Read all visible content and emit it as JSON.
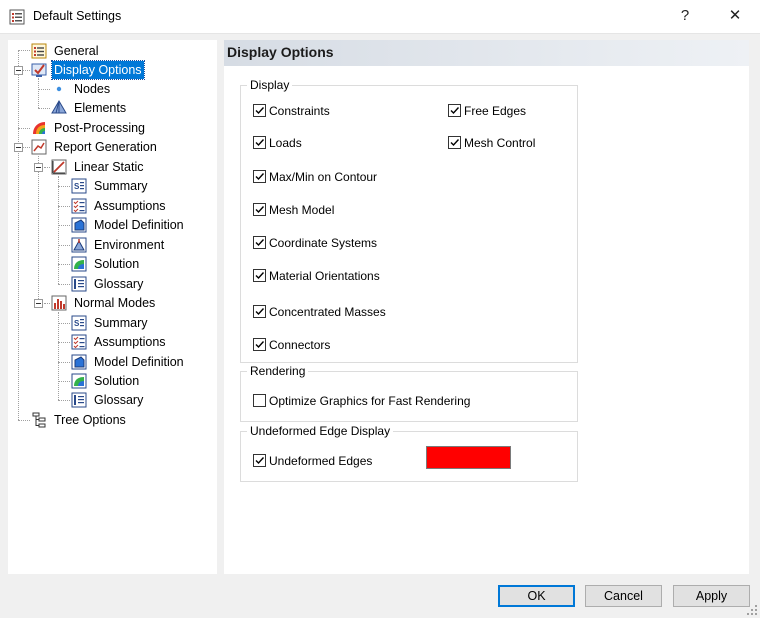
{
  "window": {
    "title": "Default Settings",
    "help_label": "?",
    "close_label": "✕"
  },
  "tree": [
    {
      "label": "General",
      "icon": "general-settings-icon"
    },
    {
      "label": "Display Options",
      "icon": "display-options-icon",
      "selected": true
    },
    {
      "label": "Nodes",
      "icon": "node-dot-icon"
    },
    {
      "label": "Elements",
      "icon": "elements-icon"
    },
    {
      "label": "Post-Processing",
      "icon": "post-processing-icon"
    },
    {
      "label": "Report Generation",
      "icon": "report-generation-icon"
    },
    {
      "label": "Linear Static",
      "icon": "linear-static-chart-icon"
    },
    {
      "label": "Summary",
      "icon": "summary-icon"
    },
    {
      "label": "Assumptions",
      "icon": "assumptions-icon"
    },
    {
      "label": "Model Definition",
      "icon": "model-definition-icon"
    },
    {
      "label": "Environment",
      "icon": "environment-icon"
    },
    {
      "label": "Solution",
      "icon": "solution-icon"
    },
    {
      "label": "Glossary",
      "icon": "glossary-icon"
    },
    {
      "label": "Normal Modes",
      "icon": "normal-modes-chart-icon"
    },
    {
      "label": "Summary",
      "icon": "summary-icon"
    },
    {
      "label": "Assumptions",
      "icon": "assumptions-icon"
    },
    {
      "label": "Model Definition",
      "icon": "model-definition-icon"
    },
    {
      "label": "Solution",
      "icon": "solution-icon"
    },
    {
      "label": "Glossary",
      "icon": "glossary-icon"
    },
    {
      "label": "Tree Options",
      "icon": "tree-options-icon"
    }
  ],
  "panel": {
    "title": "Display Options",
    "display_group": {
      "legend": "Display",
      "options": [
        {
          "label": "Constraints",
          "checked": true
        },
        {
          "label": "Loads",
          "checked": true
        },
        {
          "label": "Max/Min on Contour",
          "checked": true
        },
        {
          "label": "Mesh Model",
          "checked": true
        },
        {
          "label": "Coordinate Systems",
          "checked": true
        },
        {
          "label": "Material Orientations",
          "checked": true
        },
        {
          "label": "Concentrated Masses",
          "checked": true
        },
        {
          "label": "Connectors",
          "checked": true
        },
        {
          "label": "Free Edges",
          "checked": true
        },
        {
          "label": "Mesh Control",
          "checked": true
        }
      ]
    },
    "rendering_group": {
      "legend": "Rendering",
      "options": [
        {
          "label": "Optimize Graphics for Fast Rendering",
          "checked": false
        }
      ]
    },
    "edge_group": {
      "legend": "Undeformed Edge Display",
      "options": [
        {
          "label": "Undeformed Edges",
          "checked": true
        }
      ],
      "color": "#ff0000"
    }
  },
  "buttons": {
    "ok": "OK",
    "cancel": "Cancel",
    "apply": "Apply"
  },
  "colors": {
    "selection": "#0078d7",
    "edge_color": "#ff0000"
  }
}
